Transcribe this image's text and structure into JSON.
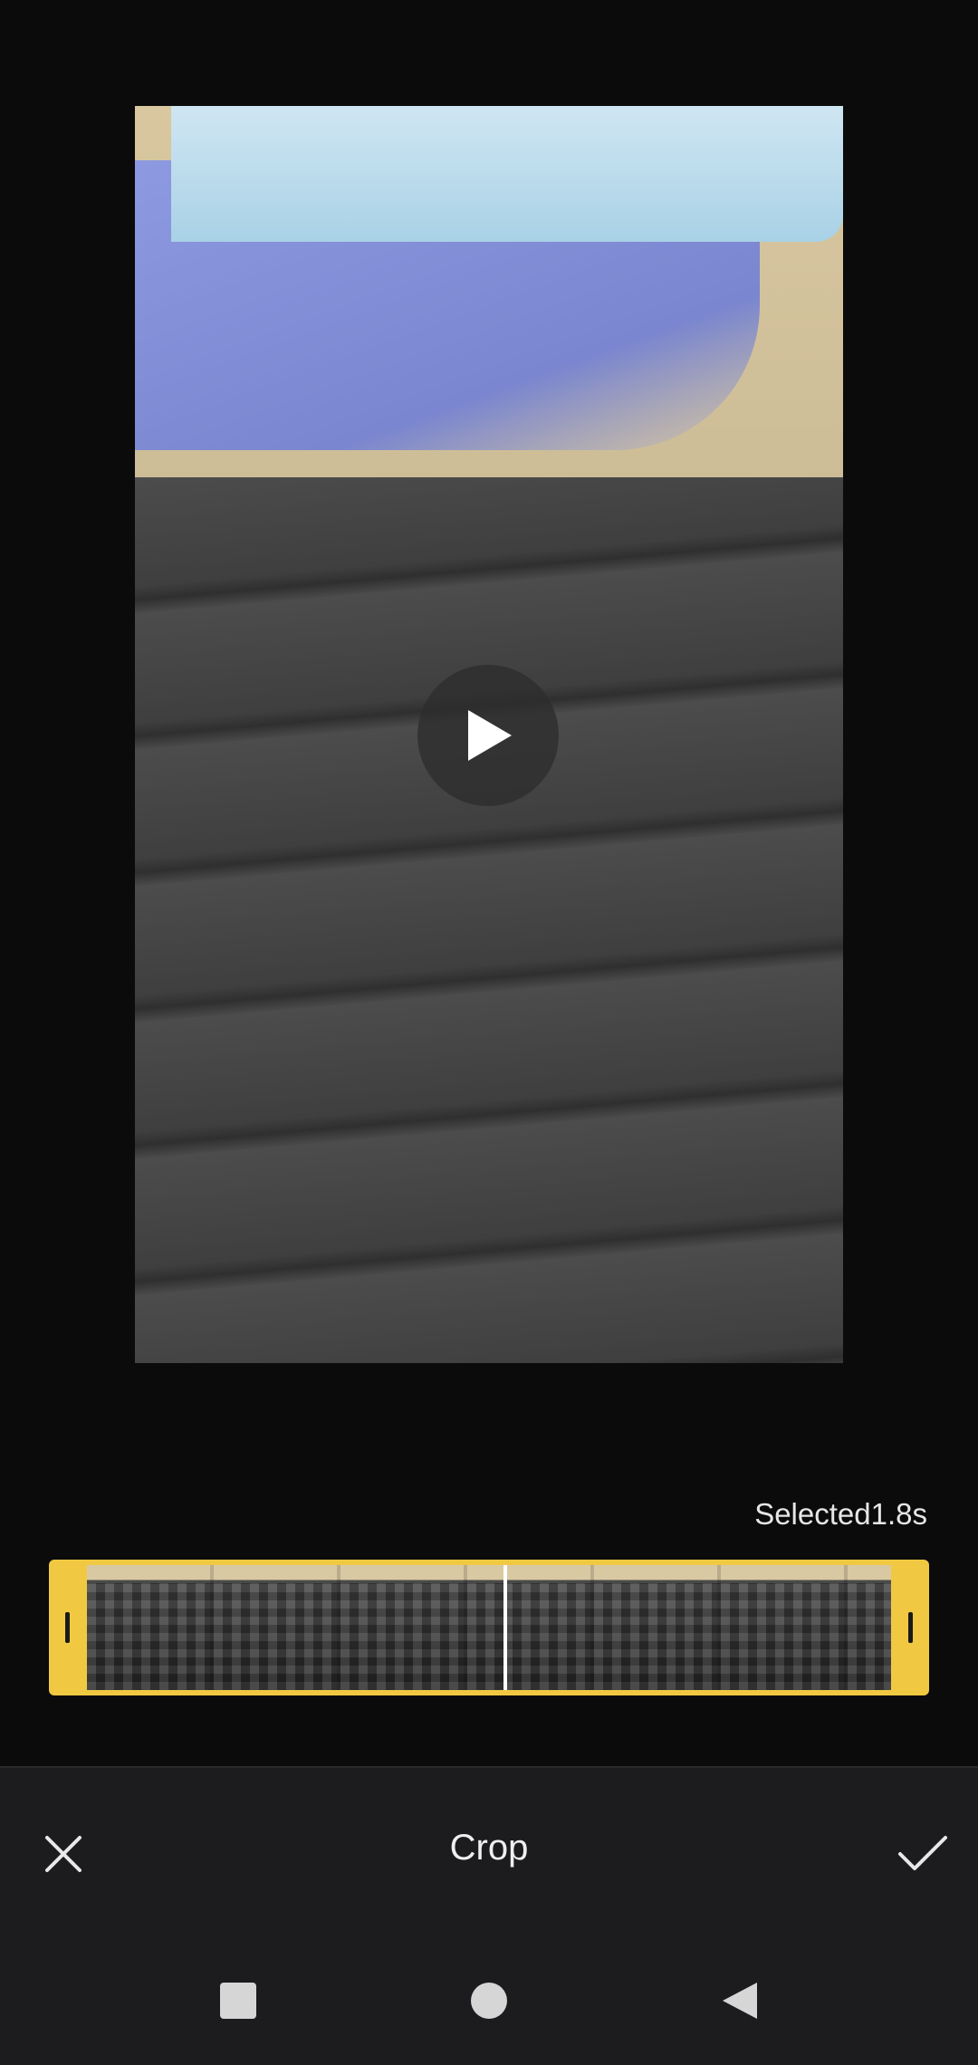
{
  "trimmer": {
    "selected_label": "Selected1.8s"
  },
  "action_bar": {
    "title": "Crop",
    "cancel_icon": "close-icon",
    "confirm_icon": "check-icon"
  },
  "system_nav": {
    "recents_icon": "square-icon",
    "home_icon": "circle-icon",
    "back_icon": "triangle-back-icon"
  },
  "colors": {
    "trim_frame": "#f1c842",
    "background": "#0b0b0c",
    "panel": "#1c1c1e"
  }
}
